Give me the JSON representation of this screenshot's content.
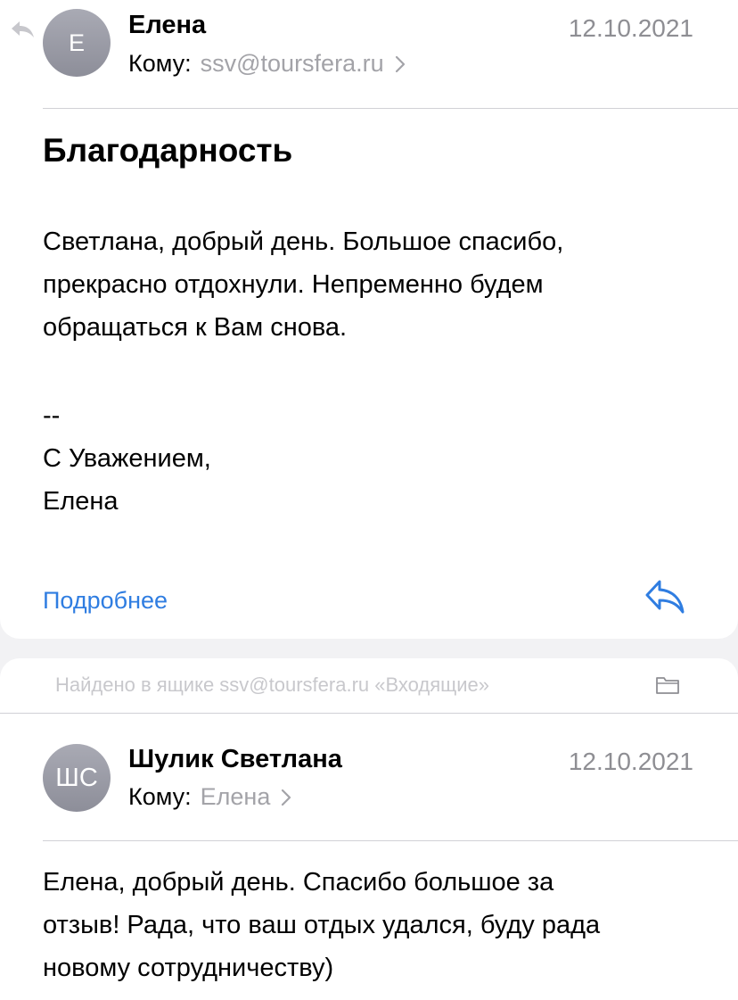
{
  "message1": {
    "avatar_initials": "Е",
    "sender": "Елена",
    "to_label": "Кому:",
    "to_value": "ssv@toursfera.ru",
    "date": "12.10.2021",
    "subject": "Благодарность",
    "body_lines": [
      "Светлана, добрый день. Большое спасибо,",
      "прекрасно отдохнули. Непременно будем",
      "обращаться к Вам снова."
    ],
    "signature_lines": [
      "--",
      "С Уважением,",
      "Елена"
    ],
    "more_link": "Подробнее"
  },
  "found_in": "Найдено в ящике ssv@toursfera.ru «Входящие»",
  "message2": {
    "avatar_initials": "ШС",
    "sender": "Шулик Светлана",
    "to_label": "Кому:",
    "to_value": "Елена",
    "date": "12.10.2021",
    "body_lines": [
      "Елена, добрый день. Спасибо большое за",
      "отзыв! Рада, что ваш отдых удался, буду рада",
      "новому сотрудничеству)"
    ]
  },
  "icons": {
    "back": "back-arrow-icon",
    "chevron": "chevron-right-icon",
    "reply": "reply-icon",
    "folder": "folder-icon"
  },
  "colors": {
    "link": "#2f7de1",
    "secondary_text": "#8e8e93",
    "avatar": "#9a9ba5",
    "background": "#f2f2f4"
  }
}
